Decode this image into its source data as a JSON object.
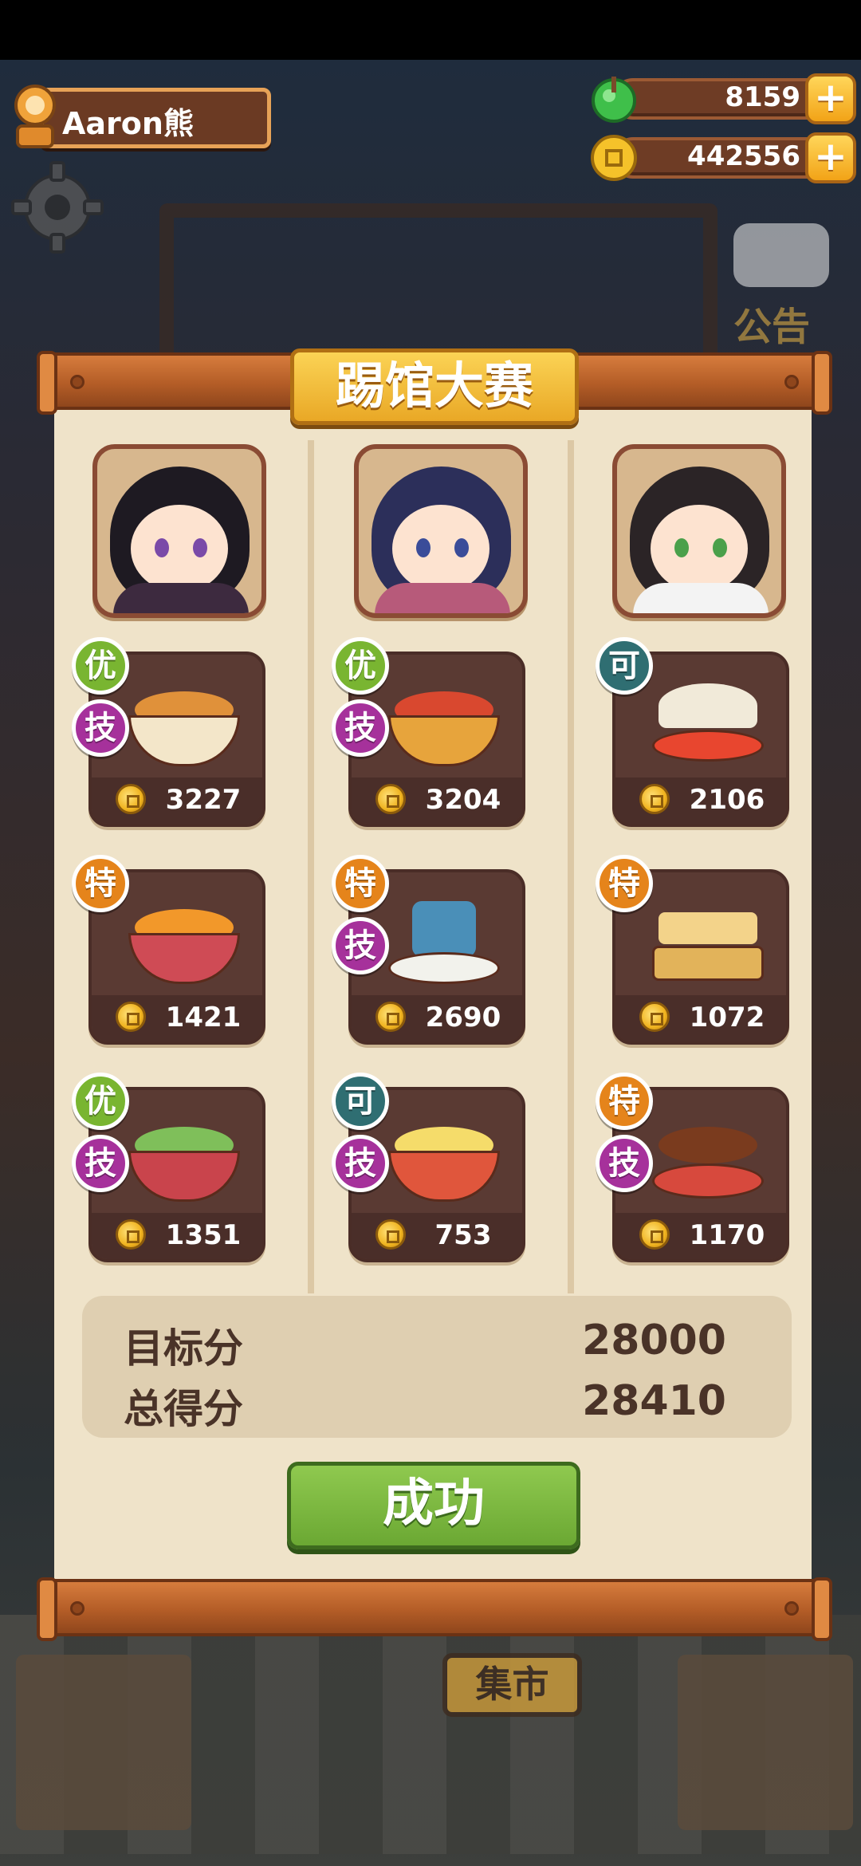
{
  "player": {
    "name": "Aaron熊"
  },
  "currencies": {
    "gems": {
      "icon": "green-gem-icon",
      "value": "8159",
      "plus": "+"
    },
    "coins": {
      "icon": "gold-coin-icon",
      "value": "442556",
      "plus": "+"
    }
  },
  "background": {
    "notice_label": "公告",
    "market_sign": "集市"
  },
  "board": {
    "title": "踢馆大赛",
    "columns": [
      {
        "portrait": "chef-portrait-elf",
        "dishes": [
          {
            "price": "3227",
            "badges": [
              "优",
              "技"
            ],
            "icon": "noodle-soup-icon"
          },
          {
            "price": "1421",
            "badges": [
              "特"
            ],
            "icon": "rice-bowl-icon"
          },
          {
            "price": "1351",
            "badges": [
              "优",
              "技"
            ],
            "icon": "seafood-salad-icon"
          }
        ]
      },
      {
        "portrait": "chef-portrait-princess",
        "dishes": [
          {
            "price": "3204",
            "badges": [
              "优",
              "技"
            ],
            "icon": "lobster-dish-icon"
          },
          {
            "price": "2690",
            "badges": [
              "特",
              "技"
            ],
            "icon": "birthday-cake-icon"
          },
          {
            "price": "753",
            "badges": [
              "可",
              "技"
            ],
            "icon": "egg-shrimp-icon"
          }
        ]
      },
      {
        "portrait": "chef-portrait-girl",
        "dishes": [
          {
            "price": "2106",
            "badges": [
              "可"
            ],
            "icon": "seashell-dish-icon"
          },
          {
            "price": "1072",
            "badges": [
              "特"
            ],
            "icon": "bento-box-icon"
          },
          {
            "price": "1170",
            "badges": [
              "特",
              "技"
            ],
            "icon": "grilled-meat-icon"
          }
        ]
      }
    ],
    "score": {
      "target_label": "目标分",
      "target_value": "28000",
      "total_label": "总得分",
      "total_value": "28410"
    },
    "result_button": "成功"
  },
  "colors": {
    "badge_you": "#79b531",
    "badge_te": "#e5841b",
    "badge_ke": "#2f6e72",
    "badge_ji": "#a6319b",
    "success": "#6ba833"
  }
}
